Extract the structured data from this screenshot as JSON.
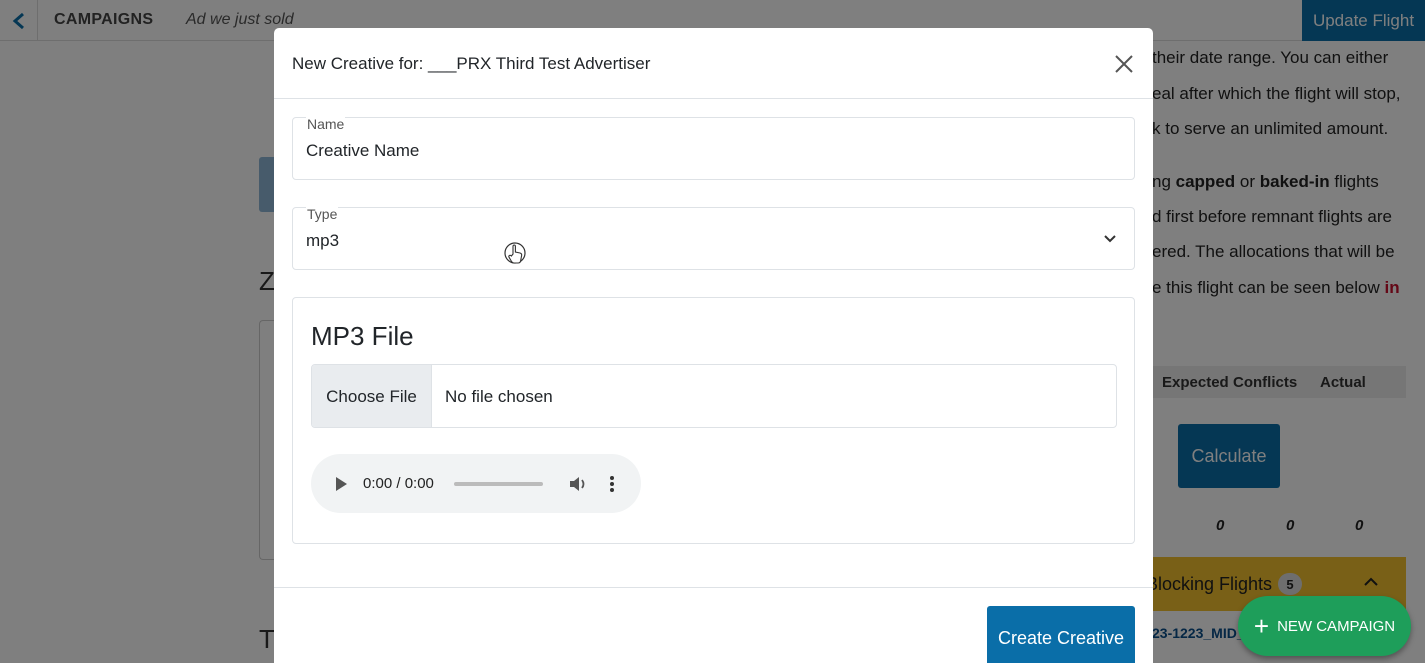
{
  "topbar": {
    "section": "CAMPAIGNS",
    "subtitle": "Ad we just sold",
    "update_button": "Update Flight"
  },
  "background_text": {
    "line1": "their date range. You can either",
    "line2": "eal after which the flight will stop,",
    "line3": "k to serve an unlimited amount.",
    "line4_pre": "ng ",
    "line4_capped": "capped",
    "line4_mid": " or ",
    "line4_baked": "baked-in",
    "line4_post": " flights",
    "line5": "d first before remnant flights are",
    "line6": "ered. The allocations that will be",
    "line7_pre": "e this flight can be seen below ",
    "line7_link": "in",
    "frag_z": "Z",
    "frag_t": "T"
  },
  "allocation": {
    "columns": [
      "Expected",
      "Conflicts",
      "Actual"
    ],
    "calculate_button": "Calculate",
    "expected": "0",
    "conflicts": "0",
    "actual": "0"
  },
  "blocking": {
    "label": "Blocking Flights",
    "count": "5",
    "flight_link": "23-1223_MID_"
  },
  "fab": {
    "label": "NEW CAMPAIGN"
  },
  "modal": {
    "title": "New Creative for: ___PRX Third Test Advertiser",
    "name_field": {
      "label": "Name",
      "value": "Creative Name"
    },
    "type_field": {
      "label": "Type",
      "value": "mp3"
    },
    "mp3_section": {
      "title": "MP3 File",
      "choose_button": "Choose File",
      "file_status": "No file chosen",
      "audio_time": "0:00 / 0:00"
    },
    "create_button": "Create Creative"
  },
  "colors": {
    "primary": "#0a6ea8",
    "success": "#1e9e5a",
    "warning": "#f2c12e",
    "danger": "#c8102e"
  }
}
